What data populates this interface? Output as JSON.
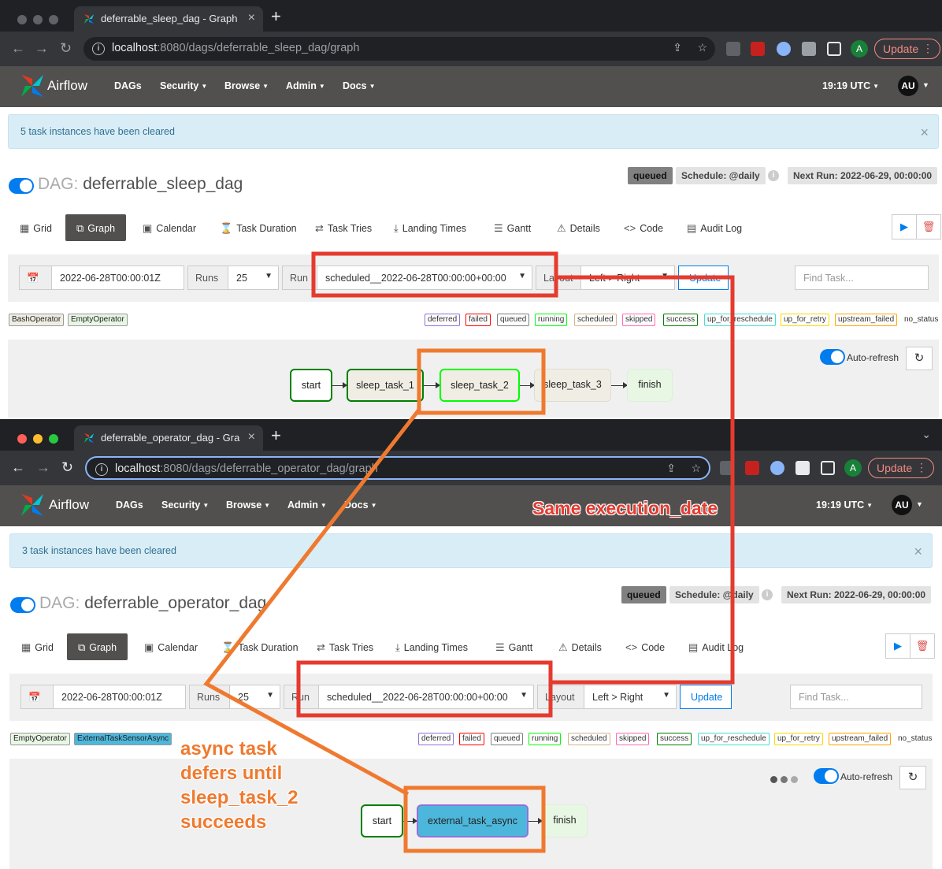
{
  "colors": {
    "accent": "#017cee",
    "navbar": "#51504f",
    "annotation_red": "#e53b2f",
    "annotation_orange": "#ef7a2f",
    "queued": "#808080"
  },
  "nav": {
    "brand": "Airflow",
    "menus": [
      "DAGs",
      "Security",
      "Browse",
      "Admin",
      "Docs"
    ],
    "time": "19:19 UTC",
    "user_initials": "AU"
  },
  "browser": {
    "update_label": "Update",
    "profile_initial": "A"
  },
  "view_tabs": [
    "Grid",
    "Graph",
    "Calendar",
    "Task Duration",
    "Task Tries",
    "Landing Times",
    "Gantt",
    "Details",
    "Code",
    "Audit Log"
  ],
  "form": {
    "runs_label": "Runs",
    "runs_value": "25",
    "run_label": "Run",
    "layout_label": "Layout",
    "layout_value": "Left > Right",
    "update_label": "Update",
    "find_placeholder": "Find Task..."
  },
  "states": [
    "deferred",
    "failed",
    "queued",
    "running",
    "scheduled",
    "skipped",
    "success",
    "up_for_reschedule",
    "up_for_retry",
    "upstream_failed",
    "no_status"
  ],
  "state_colors": [
    "#9370db",
    "#ff0000",
    "#808080",
    "#00ff00",
    "#d2b48c",
    "#ff69b4",
    "#008000",
    "#40e0d0",
    "#ffd700",
    "#ffa500"
  ],
  "window1": {
    "tab_title": "deferrable_sleep_dag - Graph",
    "url_host": "localhost",
    "url_path": ":8080/dags/deferrable_sleep_dag/graph",
    "alert": "5 task instances have been cleared",
    "dag_label": "DAG:",
    "dag_id": "deferrable_sleep_dag",
    "badge_state": "queued",
    "schedule": "Schedule: @daily",
    "next_run": "Next Run: 2022-06-29, 00:00:00",
    "base_date": "2022-06-28T00:00:01Z",
    "run_id": "scheduled__2022-06-28T00:00:00+00:00",
    "operators": [
      "BashOperator",
      "EmptyOperator"
    ],
    "auto_refresh": "Auto-refresh",
    "nodes": [
      "start",
      "sleep_task_1",
      "sleep_task_2",
      "sleep_task_3",
      "finish"
    ]
  },
  "window2": {
    "tab_title": "deferrable_operator_dag - Gra",
    "url_host": "localhost",
    "url_path": ":8080/dags/deferrable_operator_dag/graph",
    "alert": "3 task instances have been cleared",
    "dag_label": "DAG:",
    "dag_id": "deferrable_operator_dag",
    "badge_state": "queued",
    "schedule": "Schedule: @daily",
    "next_run": "Next Run: 2022-06-29, 00:00:00",
    "base_date": "2022-06-28T00:00:01Z",
    "run_id": "scheduled__2022-06-28T00:00:00+00:00",
    "operators": [
      "EmptyOperator",
      "ExternalTaskSensorAsync"
    ],
    "auto_refresh": "Auto-refresh",
    "nodes": [
      "start",
      "external_task_async",
      "finish"
    ]
  },
  "annotations": {
    "same_date": "Same execution_date",
    "async_note": [
      "async task",
      "defers until",
      "sleep_task_2",
      "succeeds"
    ]
  }
}
